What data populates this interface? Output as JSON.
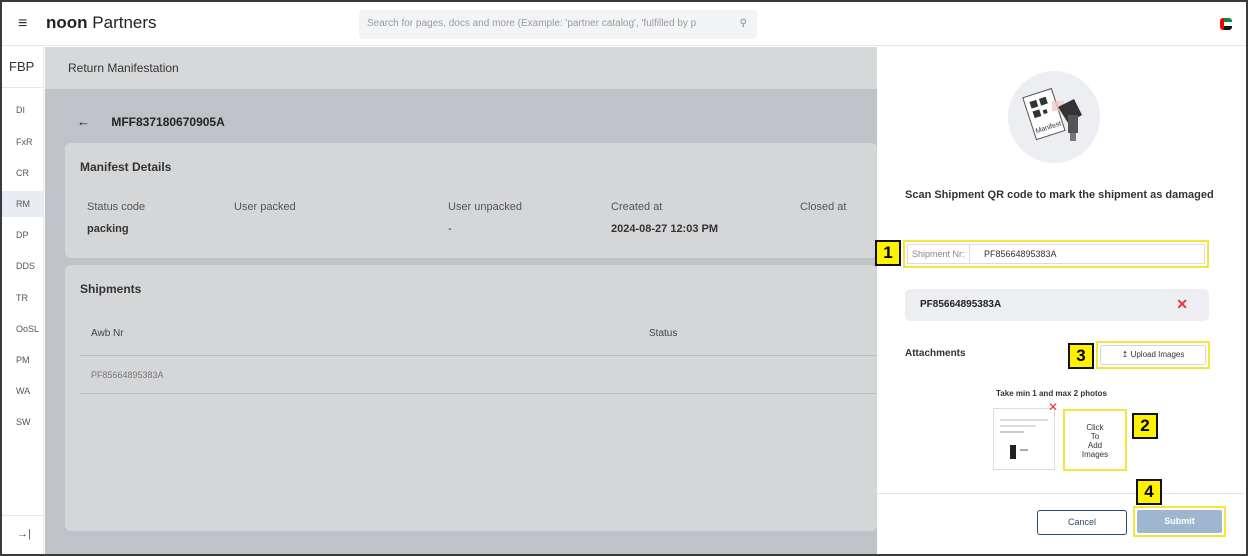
{
  "topbar": {
    "brand_bold": "noon",
    "brand_rest": " Partners",
    "search_placeholder": "Search for pages, docs and more (Example: 'partner catalog', 'fulfilled by p"
  },
  "sidebar": {
    "header": "FBP",
    "items": [
      {
        "label": "DI"
      },
      {
        "label": "FxR"
      },
      {
        "label": "CR"
      },
      {
        "label": "RM",
        "active": true
      },
      {
        "label": "DP"
      },
      {
        "label": "DDS"
      },
      {
        "label": "TR"
      },
      {
        "label": "OoSL"
      },
      {
        "label": "PM"
      },
      {
        "label": "WA"
      },
      {
        "label": "SW"
      }
    ],
    "collapse": "→|"
  },
  "main": {
    "breadcrumb": "Return Manifestation",
    "manifest_id": "MFF837180670905A",
    "manifest_details": {
      "title": "Manifest Details",
      "labels": [
        "Status code",
        "User packed",
        "User unpacked",
        "Created at",
        "Closed at"
      ],
      "status_code": "packing",
      "user_unpacked": "-",
      "created_at": "2024-08-27 12:03 PM"
    },
    "shipments": {
      "title": "Shipments",
      "columns": [
        "Awb Nr",
        "Status"
      ],
      "rows": [
        {
          "awb": "PF85664895383A"
        }
      ]
    }
  },
  "panel": {
    "illustration_text": "Manifest",
    "title": "Scan Shipment QR code to mark the shipment as damaged",
    "shipment_label": "Shipment Nr:",
    "shipment_value": "PF85664895383A",
    "scanned": "PF85664895383A",
    "attachments_label": "Attachments",
    "upload_label": "Upload Images",
    "photo_hint": "Take min 1 and max 2 photos",
    "add_images": [
      "Click",
      "To",
      "Add",
      "Images"
    ],
    "cancel_label": "Cancel",
    "submit_label": "Submit"
  },
  "callouts": [
    "1",
    "2",
    "3",
    "4"
  ],
  "colors": {
    "highlight": "#f5e63a",
    "submit_disabled": "#9eb6cf",
    "remove_x": "#e33333",
    "accent_navy": "#2c4a6b"
  }
}
